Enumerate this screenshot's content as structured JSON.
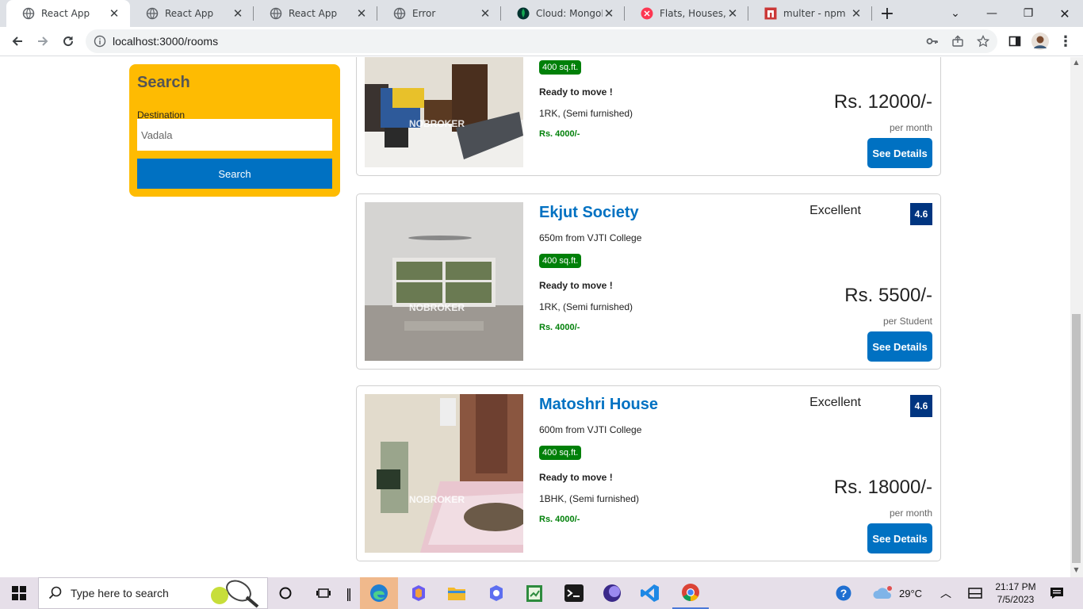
{
  "browser": {
    "tabs": [
      {
        "title": "React App",
        "icon": "globe-icon",
        "active": true
      },
      {
        "title": "React App",
        "icon": "globe-icon",
        "active": false
      },
      {
        "title": "React App",
        "icon": "globe-icon",
        "active": false
      },
      {
        "title": "Error",
        "icon": "globe-icon",
        "active": false
      },
      {
        "title": "Cloud: MongoDB",
        "icon": "mongodb-leaf-icon",
        "active": false
      },
      {
        "title": "Flats, Houses, Ap",
        "icon": "nobroker-icon",
        "active": false
      },
      {
        "title": "multer - npm",
        "icon": "npm-icon",
        "active": false
      }
    ],
    "new_tab_label": "+",
    "url": "localhost:3000/rooms"
  },
  "search": {
    "title": "Search",
    "destination_label": "Destination",
    "destination_value": "Vadala",
    "button_label": "Search"
  },
  "listings": [
    {
      "name": "",
      "distance": "",
      "area": "400 sq.ft.",
      "status": "Ready to move !",
      "room": "1RK, (Semi furnished)",
      "deposit": "Rs. 4000/-",
      "rating_text": "",
      "rating": "",
      "price": "Rs. 12000/-",
      "period": "per month",
      "button": "See Details",
      "watermark": "NOBROKER"
    },
    {
      "name": "Ekjut Society",
      "distance": "650m from VJTI College",
      "area": "400 sq.ft.",
      "status": "Ready to move !",
      "room": "1RK, (Semi furnished)",
      "deposit": "Rs. 4000/-",
      "rating_text": "Excellent",
      "rating": "4.6",
      "price": "Rs. 5500/-",
      "period": "per Student",
      "button": "See Details",
      "watermark": "NOBROKER"
    },
    {
      "name": "Matoshri House",
      "distance": "600m from VJTI College",
      "area": "400 sq.ft.",
      "status": "Ready to move !",
      "room": "1BHK, (Semi furnished)",
      "deposit": "Rs. 4000/-",
      "rating_text": "Excellent",
      "rating": "4.6",
      "price": "Rs. 18000/-",
      "period": "per month",
      "button": "See Details",
      "watermark": "NOBROKER"
    }
  ],
  "taskbar": {
    "search_placeholder": "Type here to search",
    "weather": "29°C",
    "time": "21:17 PM",
    "date": "7/5/2023"
  },
  "colors": {
    "accent": "#0071c2",
    "search_bg": "#febb02",
    "rating_bg": "#003580",
    "green": "#008009"
  }
}
